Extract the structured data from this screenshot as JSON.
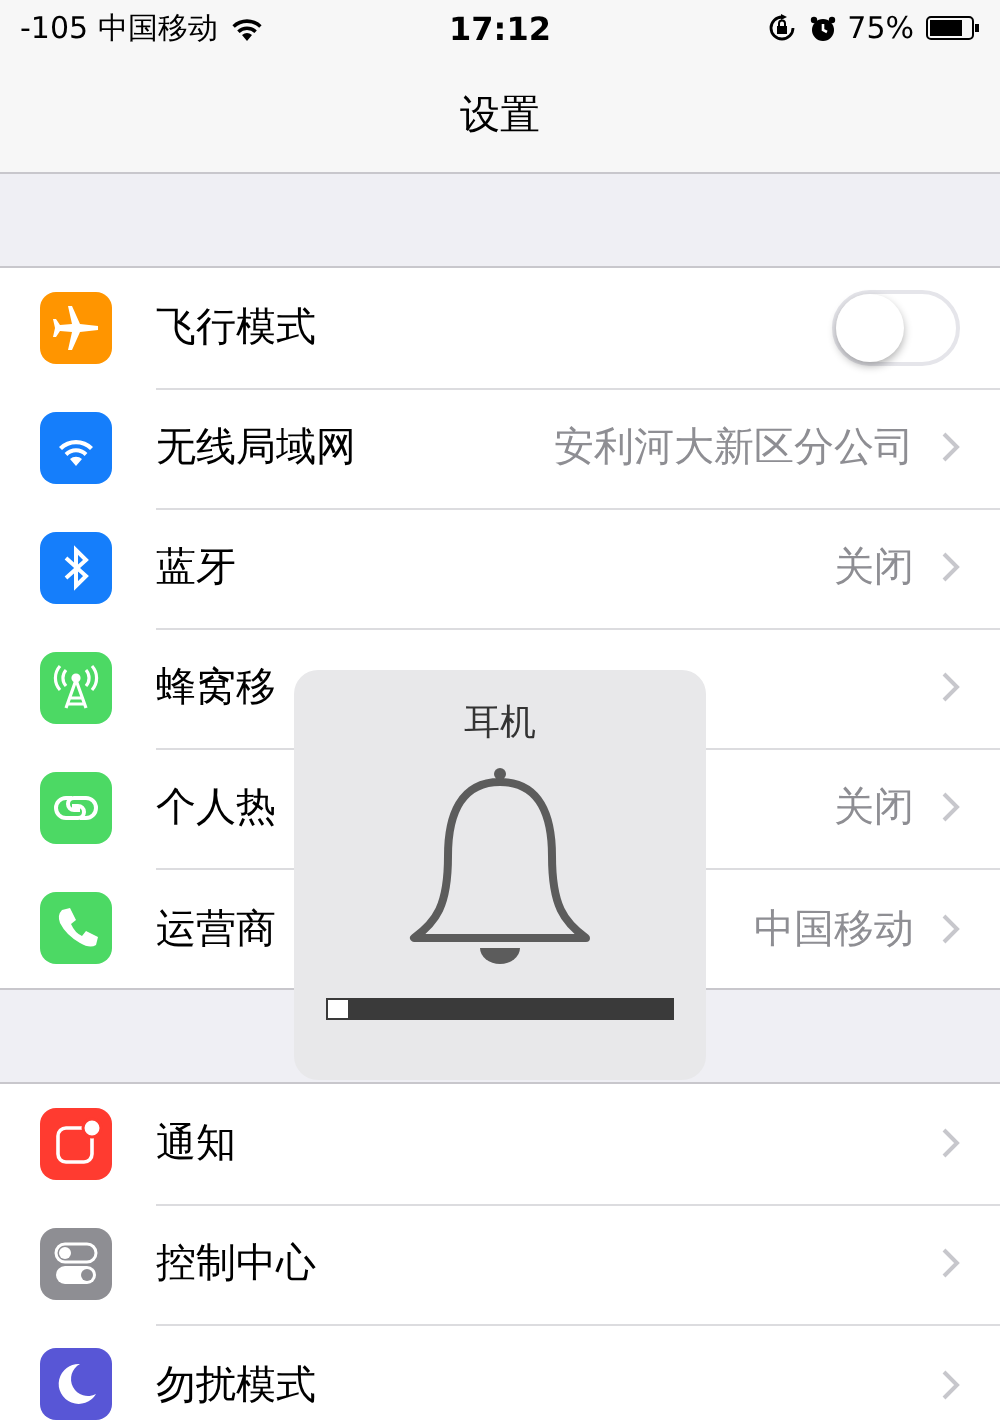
{
  "status_bar": {
    "carrier": "-105 中国移动",
    "time": "17:12",
    "battery": "75%"
  },
  "title": "设置",
  "groups": [
    {
      "rows": [
        {
          "kind": "toggle",
          "label": "飞行模式",
          "color": "#ff9500",
          "on": false
        },
        {
          "kind": "link",
          "label": "无线局域网",
          "color": "#157efb",
          "value": "安利河大新区分公司"
        },
        {
          "kind": "link",
          "label": "蓝牙",
          "color": "#157efb",
          "value": "关闭"
        },
        {
          "kind": "link",
          "label": "蜂窝移",
          "color": "#4cd964"
        },
        {
          "kind": "link",
          "label": "个人热",
          "color": "#4cd964",
          "value": "关闭"
        },
        {
          "kind": "link",
          "label": "运营商",
          "color": "#4cd964",
          "value": "中国移动"
        }
      ]
    },
    {
      "rows": [
        {
          "kind": "link",
          "label": "通知",
          "color": "#ff3b30"
        },
        {
          "kind": "link",
          "label": "控制中心",
          "color": "#8e8e93"
        },
        {
          "kind": "link",
          "label": "勿扰模式",
          "color": "#5856d6"
        }
      ]
    }
  ],
  "hud": {
    "title": "耳机",
    "level": 0.06
  }
}
